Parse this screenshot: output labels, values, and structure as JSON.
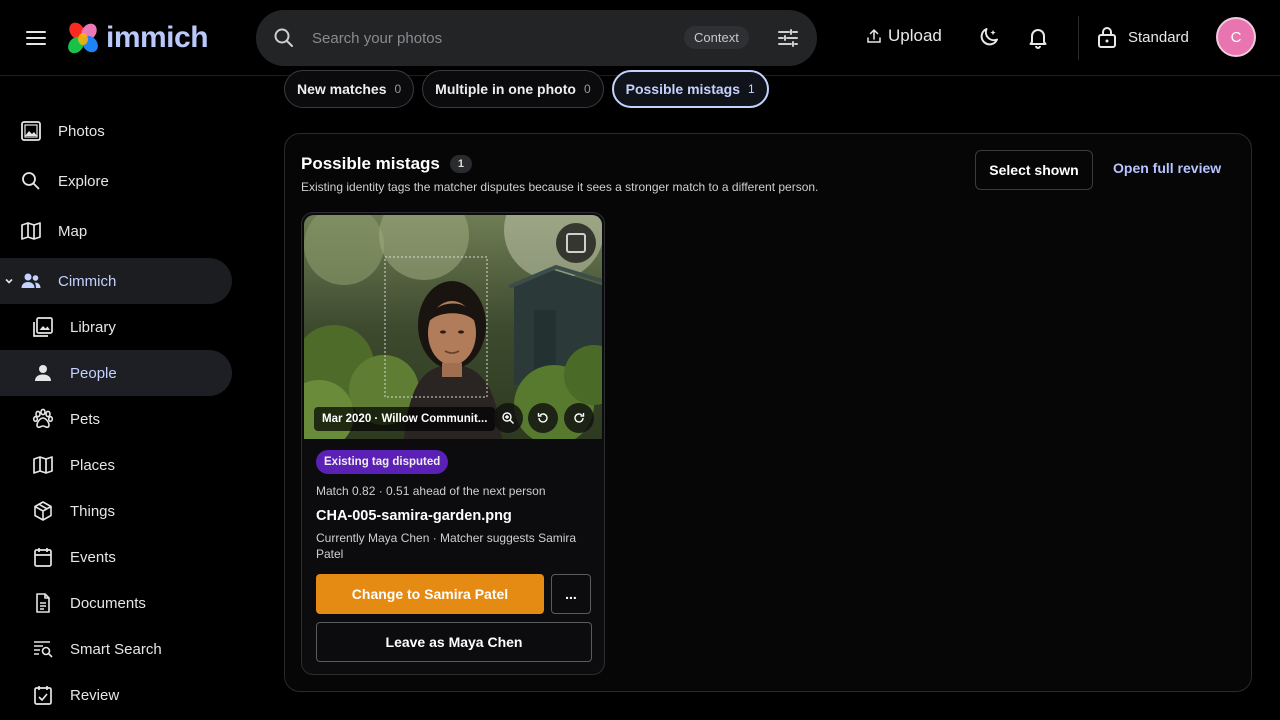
{
  "app": {
    "name": "immich",
    "brand_color": "#b9c9fb",
    "accent": "#e58a12"
  },
  "header": {
    "search_placeholder": "Search your photos",
    "context_label": "Context",
    "upload_label": "Upload",
    "mode_label": "Standard",
    "avatar_initial": "C",
    "avatar_color": "#e975b0",
    "icons": [
      "menu-icon",
      "search-icon",
      "filter-icon",
      "upload-icon",
      "moon-icon",
      "bell-icon",
      "lock-icon"
    ]
  },
  "sidebar": {
    "items": [
      {
        "label": "Photos",
        "icon": "photos-icon"
      },
      {
        "label": "Explore",
        "icon": "search-icon"
      },
      {
        "label": "Map",
        "icon": "map-icon"
      },
      {
        "label": "Cimmich",
        "icon": "people-group-icon",
        "expanded": true
      },
      {
        "label": "Library",
        "icon": "library-icon"
      },
      {
        "label": "People",
        "icon": "person-icon",
        "active": true
      },
      {
        "label": "Pets",
        "icon": "paw-icon"
      },
      {
        "label": "Places",
        "icon": "map-icon"
      },
      {
        "label": "Things",
        "icon": "cube-icon"
      },
      {
        "label": "Events",
        "icon": "calendar-icon"
      },
      {
        "label": "Documents",
        "icon": "document-icon"
      },
      {
        "label": "Smart Search",
        "icon": "smart-search-icon"
      },
      {
        "label": "Review",
        "icon": "review-icon"
      }
    ]
  },
  "tabs": [
    {
      "label": "New matches",
      "count": "0"
    },
    {
      "label": "Multiple in one photo",
      "count": "0"
    },
    {
      "label": "Possible mistags",
      "count": "1",
      "active": true
    }
  ],
  "panel": {
    "title": "Possible mistags",
    "count": "1",
    "subtitle": "Existing identity tags the matcher disputes because it sees a stronger match to a different person.",
    "select_shown_label": "Select shown",
    "open_review_label": "Open full review"
  },
  "card": {
    "caption": "Mar 2020 · Willow Communit...",
    "status_badge": "Existing tag disputed",
    "match_line": "Match 0.82 · 0.51 ahead of the next person",
    "filename": "CHA-005-samira-garden.png",
    "suggestion": "Currently Maya Chen · Matcher suggests Samira Patel",
    "change_label": "Change to Samira Patel",
    "more_label": "...",
    "leave_label": "Leave as Maya Chen"
  }
}
